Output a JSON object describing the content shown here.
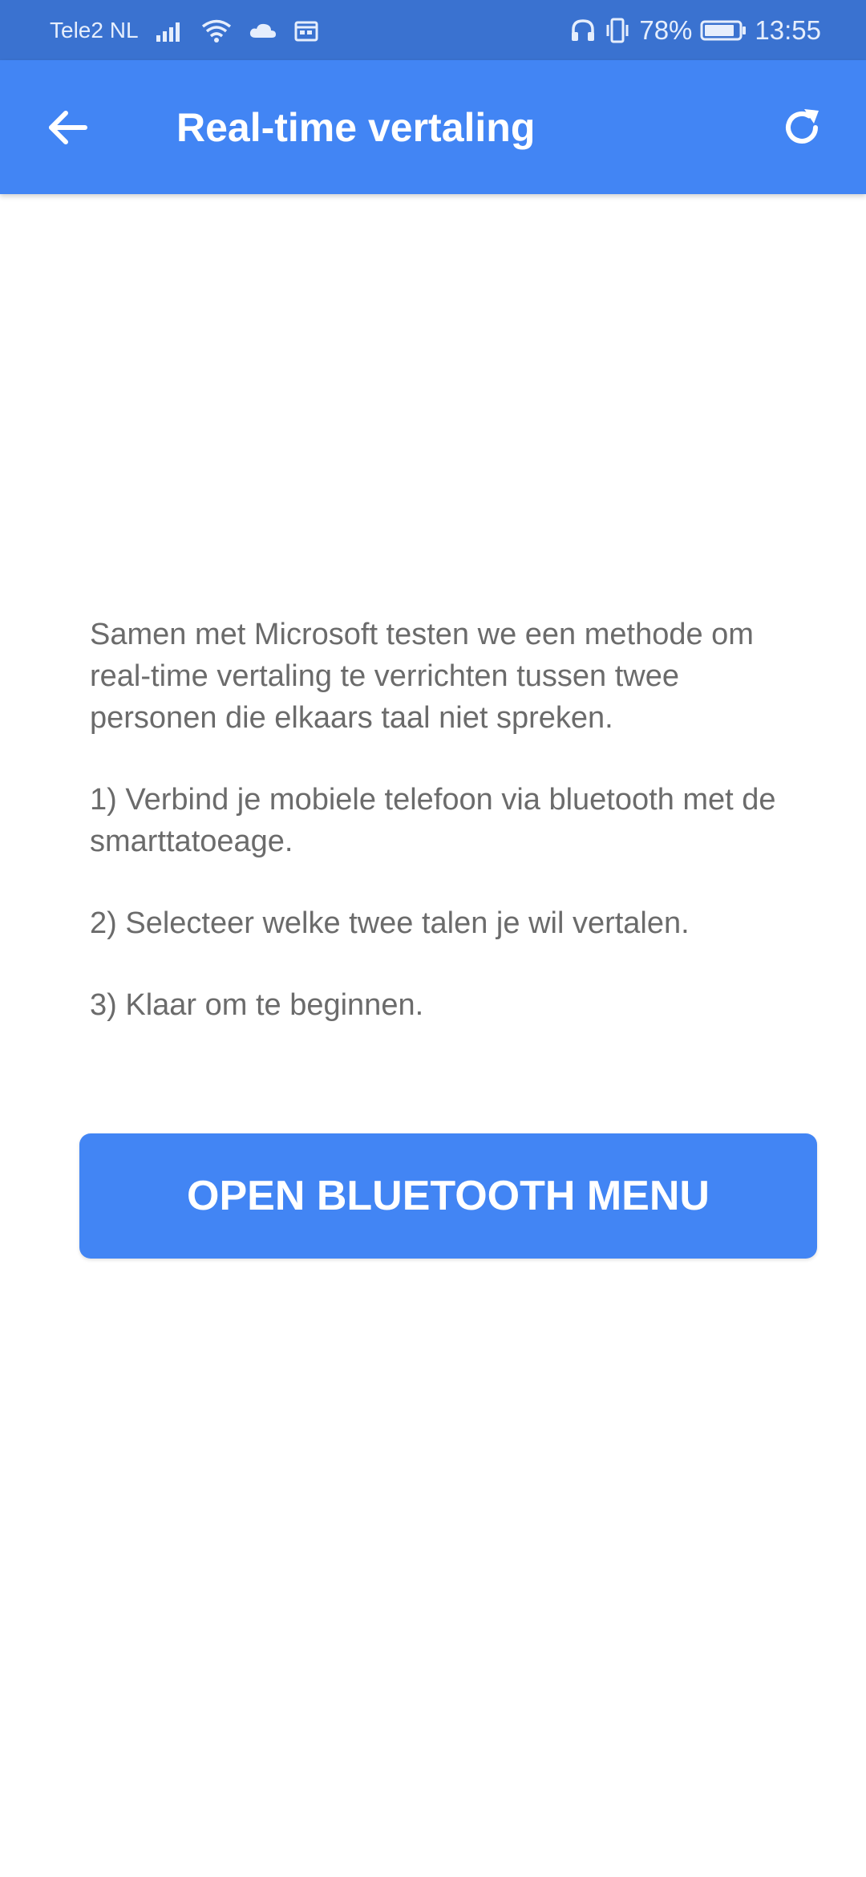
{
  "status_bar": {
    "carrier": "Tele2 NL",
    "battery_percent": "78%",
    "time": "13:55",
    "icons_left": [
      "signal-icon",
      "wifi-icon",
      "cloud-icon",
      "calendar-icon"
    ],
    "icons_right": [
      "headphones-icon",
      "vibrate-icon",
      "battery-icon"
    ]
  },
  "app_bar": {
    "title": "Real-time vertaling",
    "back_icon": "arrow-left-icon",
    "refresh_icon": "refresh-icon"
  },
  "content": {
    "intro": "Samen met Microsoft testen we een methode om real-time vertaling te verrichten tussen twee personen die elkaars taal niet spreken.",
    "step1": "1) Verbind je mobiele telefoon via bluetooth met de smarttatoeage.",
    "step2": "2) Selecteer welke twee talen je wil vertalen.",
    "step3": "3) Klaar om te beginnen."
  },
  "actions": {
    "open_bluetooth_label": "OPEN BLUETOOTH MENU"
  },
  "colors": {
    "status_bar": "#3a72d0",
    "primary": "#4285f4",
    "text": "#6b6b6b",
    "background": "#ffffff"
  }
}
